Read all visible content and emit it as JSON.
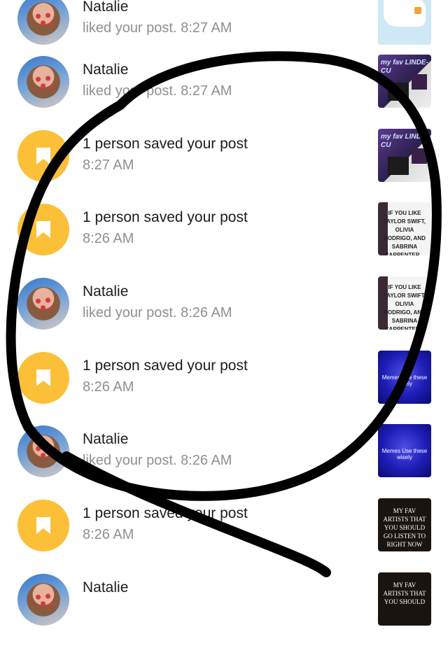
{
  "notifications": [
    {
      "kind": "like",
      "title": "Natalie",
      "sub": "liked your post. 8:27 AM",
      "thumb": "map",
      "thumb_text": ""
    },
    {
      "kind": "like",
      "title": "Natalie",
      "sub": "liked your post. 8:27 AM",
      "thumb": "fav",
      "thumb_text": "my fav LINDE-CU"
    },
    {
      "kind": "save",
      "title": "1 person saved your post",
      "sub": "8:27 AM",
      "thumb": "fav",
      "thumb_text": "my fav LINDE-CU"
    },
    {
      "kind": "save",
      "title": "1 person saved your post",
      "sub": "8:26 AM",
      "thumb": "taylor",
      "thumb_text": "IF YOU LIKE TAYLOR SWIFT, OLIVIA RODRIGO, AND SABRINA CARPENTER..."
    },
    {
      "kind": "like",
      "title": "Natalie",
      "sub": "liked your post. 8:26 AM",
      "thumb": "taylor",
      "thumb_text": "IF YOU LIKE TAYLOR SWIFT, OLIVIA RODRIGO, AND SABRINA CARPENTER..."
    },
    {
      "kind": "save",
      "title": "1 person saved your post",
      "sub": "8:26 AM",
      "thumb": "blue",
      "thumb_text": "Memes Use these wisely"
    },
    {
      "kind": "like",
      "title": "Natalie",
      "sub": "liked your post. 8:26 AM",
      "thumb": "blue",
      "thumb_text": "Memes Use these wisely"
    },
    {
      "kind": "save",
      "title": "1 person saved your post",
      "sub": "8:26 AM",
      "thumb": "dark",
      "thumb_text": "MY FAV ARTISTS THAT YOU SHOULD GO LISTEN TO RIGHT NOW"
    },
    {
      "kind": "like",
      "title": "Natalie",
      "sub": "",
      "thumb": "dark",
      "thumb_text": "MY FAV ARTISTS THAT YOU SHOULD"
    }
  ],
  "colors": {
    "save_badge": "#fbc037",
    "title": "#1c1c1c",
    "subtitle": "#8f8f8f",
    "scribble": "#000000"
  },
  "icons": {
    "like_avatar": "avatar-photo",
    "save_avatar": "bookmark-icon"
  }
}
